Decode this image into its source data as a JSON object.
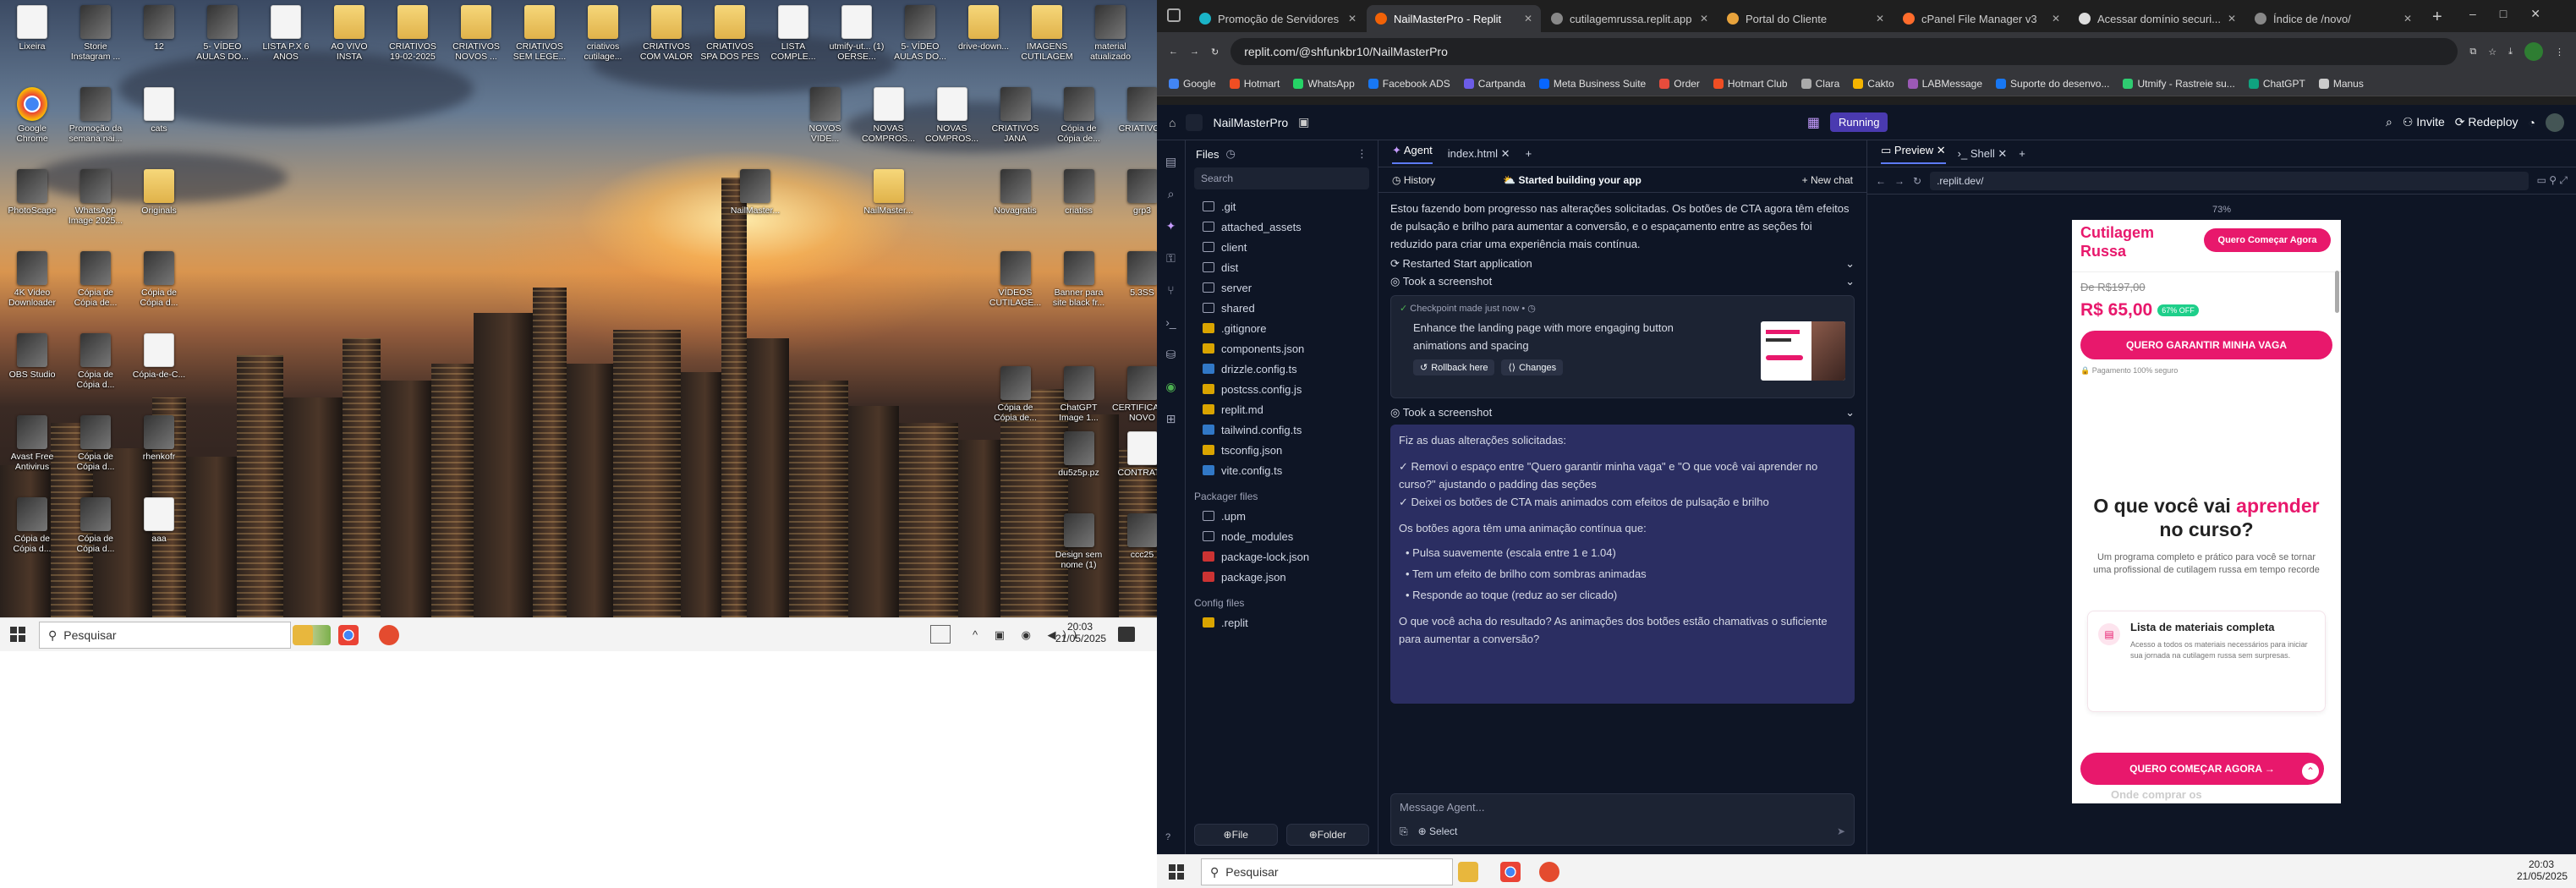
{
  "desktop": {
    "icons": [
      {
        "label": "Lixeira",
        "type": "doc"
      },
      {
        "label": "Storie Instagram ...",
        "type": "vid"
      },
      {
        "label": "12",
        "type": "vid"
      },
      {
        "label": "5- VÍDEO AULAS DO...",
        "type": "vid"
      },
      {
        "label": "LISTA P.X 6 ANOS",
        "type": "doc"
      },
      {
        "label": "AO VIVO INSTA",
        "type": "folder"
      },
      {
        "label": "CRIATIVOS 19-02-2025",
        "type": "folder"
      },
      {
        "label": "CRIATIVOS NOVOS ...",
        "type": "folder"
      },
      {
        "label": "CRIATIVOS SEM LEGE...",
        "type": "folder"
      },
      {
        "label": "criativos cutilage...",
        "type": "folder"
      },
      {
        "label": "CRIATIVOS COM VALOR",
        "type": "folder"
      },
      {
        "label": "CRIATIVOS SPA DOS PES",
        "type": "folder"
      },
      {
        "label": "LISTA COMPLE...",
        "type": "doc"
      },
      {
        "label": "utmify-ut... (1) OERSE...",
        "type": "doc"
      },
      {
        "label": "5- VÍDEO AULAS DO...",
        "type": "vid"
      },
      {
        "label": "drive-down...",
        "type": "folder"
      },
      {
        "label": "IMAGENS CUTILAGEM",
        "type": "folder"
      },
      {
        "label": "material atualizado",
        "type": "vid"
      },
      {
        "label": "Google Chrome",
        "type": "chrome"
      },
      {
        "label": "Promoção da semana nai...",
        "type": "vid"
      },
      {
        "label": "cats",
        "type": "doc"
      },
      {
        "label": "NOVOS VIDE...",
        "type": "vid"
      },
      {
        "label": "NOVAS COMPROS...",
        "type": "doc"
      },
      {
        "label": "NOVAS COMPROS...",
        "type": "doc"
      },
      {
        "label": "CRIATIVOS JANA",
        "type": "vid"
      },
      {
        "label": "Cópia de Cópia de...",
        "type": "vid"
      },
      {
        "label": "CRIATIVOS",
        "type": "vid"
      },
      {
        "label": "PhotoScape",
        "type": "vid"
      },
      {
        "label": "WhatsApp Image 2025...",
        "type": "vid"
      },
      {
        "label": "Originals",
        "type": "folder"
      },
      {
        "label": "NailMaster...",
        "type": "vid"
      },
      {
        "label": "NailMaster...",
        "type": "folder"
      },
      {
        "label": "Novagratis",
        "type": "vid"
      },
      {
        "label": "criatiss",
        "type": "vid"
      },
      {
        "label": "grp3",
        "type": "vid"
      },
      {
        "label": "4K Video Downloader",
        "type": "vid"
      },
      {
        "label": "Cópia de Cópia de...",
        "type": "vid"
      },
      {
        "label": "Cópia de Cópia d...",
        "type": "vid"
      },
      {
        "label": "VÍDEOS CUTILAGE...",
        "type": "vid"
      },
      {
        "label": "Banner para site black fr...",
        "type": "vid"
      },
      {
        "label": "5.3SS",
        "type": "vid"
      },
      {
        "label": "OBS Studio",
        "type": "vid"
      },
      {
        "label": "Cópia de Cópia d...",
        "type": "vid"
      },
      {
        "label": "Cópia-de-C...",
        "type": "doc"
      },
      {
        "label": "Cópia de Cópia de...",
        "type": "vid"
      },
      {
        "label": "ChatGPT Image 1...",
        "type": "vid"
      },
      {
        "label": "CERTIFICADO NOVO",
        "type": "vid"
      },
      {
        "label": "Avast Free Antivirus",
        "type": "vid"
      },
      {
        "label": "Cópia de Cópia d...",
        "type": "vid"
      },
      {
        "label": "rhenkofr",
        "type": "vid"
      },
      {
        "label": "du5z5p.pz",
        "type": "vid"
      },
      {
        "label": "CONTRATO",
        "type": "doc"
      },
      {
        "label": "Cópia de Cópia d...",
        "type": "vid"
      },
      {
        "label": "Cópia de Cópia d...",
        "type": "vid"
      },
      {
        "label": "aaa",
        "type": "doc"
      },
      {
        "label": "Design sem nome (1)",
        "type": "vid"
      },
      {
        "label": "ccc25",
        "type": "vid"
      }
    ]
  },
  "taskbar": {
    "search": "Pesquisar",
    "time": "20:03",
    "date": "21/05/2025"
  },
  "browser": {
    "tabs": [
      {
        "label": "Promoção de Servidores",
        "color": "#1ab4c8"
      },
      {
        "label": "NailMasterPro - Replit",
        "color": "#f26207",
        "active": true
      },
      {
        "label": "cutilagemrussa.replit.app",
        "color": "#888"
      },
      {
        "label": "Portal do Cliente",
        "color": "#e8a33c"
      },
      {
        "label": "cPanel File Manager v3",
        "color": "#ff6c2c"
      },
      {
        "label": "Acessar domínio securi...",
        "color": "#ddd"
      },
      {
        "label": "Índice de /novo/",
        "color": "#888"
      }
    ],
    "url": "replit.com/@shfunkbr10/NailMasterPro",
    "bookmarks": [
      {
        "label": "Google",
        "color": "#4285f4"
      },
      {
        "label": "Hotmart",
        "color": "#f04e23"
      },
      {
        "label": "WhatsApp",
        "color": "#25d366"
      },
      {
        "label": "Facebook ADS",
        "color": "#1877f2"
      },
      {
        "label": "Cartpanda",
        "color": "#6c5ce7"
      },
      {
        "label": "Meta Business Suite",
        "color": "#0866ff"
      },
      {
        "label": "Order",
        "color": "#e74c3c"
      },
      {
        "label": "Hotmart Club",
        "color": "#f04e23"
      },
      {
        "label": "Clara",
        "color": "#aaa"
      },
      {
        "label": "Cakto",
        "color": "#f5b400"
      },
      {
        "label": "LABMessage",
        "color": "#9b59b6"
      },
      {
        "label": "Suporte do desenvo...",
        "color": "#1877f2"
      },
      {
        "label": "Utmify - Rastreie su...",
        "color": "#2ecc71"
      },
      {
        "label": "ChatGPT",
        "color": "#10a37f"
      },
      {
        "label": "Manus",
        "color": "#ccc"
      }
    ]
  },
  "replit": {
    "project": "NailMasterPro",
    "status": "Running",
    "invite": "Invite",
    "redeploy": "Redeploy",
    "files": {
      "title": "Files",
      "search": "Search",
      "items": [
        ".git",
        "attached_assets",
        "client",
        "dist",
        "server",
        "shared",
        ".gitignore",
        "components.json",
        "drizzle.config.ts",
        "postcss.config.js",
        "replit.md",
        "tailwind.config.ts",
        "tsconfig.json",
        "vite.config.ts"
      ],
      "packager_title": "Packager files",
      "packager": [
        ".upm",
        "node_modules",
        "package-lock.json",
        "package.json"
      ],
      "config_title": "Config files",
      "config": [
        ".replit"
      ],
      "file_btn": "File",
      "folder_btn": "Folder"
    },
    "chat": {
      "tab_agent": "Agent",
      "tab_index": "index.html",
      "history": "History",
      "status": "Started building your app",
      "new_chat": "New chat",
      "msg1": "Estou fazendo bom progresso nas alterações solicitadas. Os botões de CTA agora têm efeitos de pulsação e brilho para aumentar a conversão, e o espaçamento entre as seções foi reduzido para criar uma experiência mais contínua.",
      "restarted": "Restarted Start application",
      "screenshot1": "Took a screenshot",
      "checkpoint": "Checkpoint made just now",
      "checkpoint_msg": "Enhance the landing page with more engaging button animations and spacing",
      "rollback": "Rollback here",
      "changes": "Changes",
      "screenshot2": "Took a screenshot",
      "r_intro": "Fiz as duas alterações solicitadas:",
      "r_c1": "✓ Removi o espaço entre \"Quero garantir minha vaga\" e \"O que você vai aprender no curso?\" ajustando o padding das seções",
      "r_c2": "✓ Deixei os botões de CTA mais animados com efeitos de pulsação e brilho",
      "r_anim": "Os botões agora têm uma animação contínua que:",
      "r_b1": "Pulsa suavemente (escala entre 1 e 1.04)",
      "r_b2": "Tem um efeito de brilho com sombras animadas",
      "r_b3": "Responde ao toque (reduz ao ser clicado)",
      "r_q": "O que você acha do resultado? As animações dos botões estão chamativas o suficiente para aumentar a conversão?",
      "placeholder": "Message Agent...",
      "select": "Select"
    },
    "preview": {
      "tab_preview": "Preview",
      "tab_shell": "Shell",
      "url": ".replit.dev/",
      "zoom": "73%",
      "brand1": "Cutilagem",
      "brand2": "Russa",
      "header_cta": "Quero Começar Agora",
      "old_price": "De R$197,00",
      "price": "R$ 65,00",
      "discount": "67% OFF",
      "cta": "QUERO GARANTIR MINHA VAGA",
      "secure": "Pagamento 100% seguro",
      "h_pre": "O que você vai",
      "h_accent": "aprender",
      "h_post": "no curso?",
      "sub": "Um programa completo e prático para você se tornar uma profissional de cutilagem russa em tempo recorde",
      "card_title": "Lista de materiais completa",
      "card_text": "Acesso a todos os materiais necessários para iniciar sua jornada na cutilagem russa sem surpresas.",
      "sticky_cta": "QUERO COMEÇAR AGORA →",
      "peek": "Onde comprar os"
    }
  }
}
